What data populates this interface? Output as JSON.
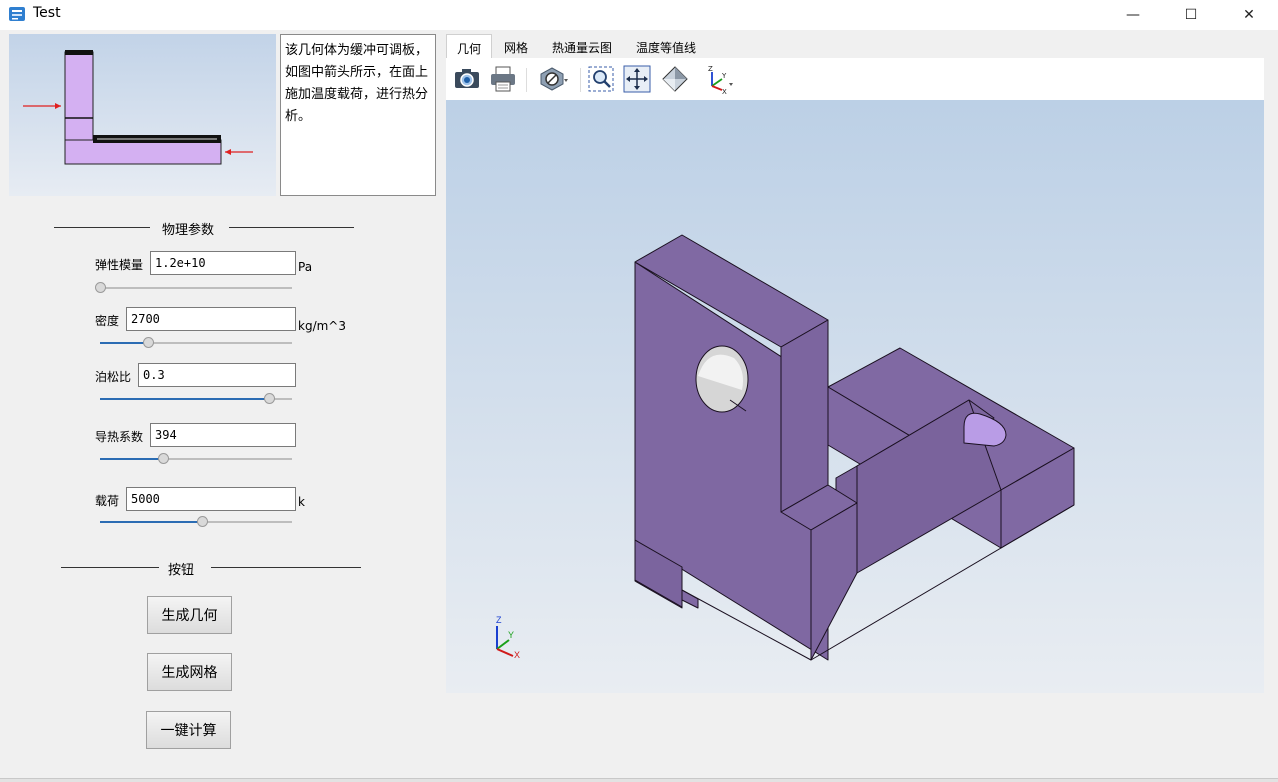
{
  "window": {
    "title": "Test",
    "minimize": "—",
    "maximize": "☐",
    "close": "✕"
  },
  "description": "该几何体为缓冲可调板，如图中箭头所示，在面上施加温度载荷，进行热分析。",
  "physics_group": {
    "title": "物理参数"
  },
  "params": [
    {
      "label": "弹性模量",
      "value": "1.2e+10",
      "unit": "Pa",
      "slider": 0.0
    },
    {
      "label": "密度",
      "value": "2700",
      "unit": "kg/m^3",
      "slider": 0.25
    },
    {
      "label": "泊松比",
      "value": "0.3",
      "unit": "",
      "slider": 0.88
    },
    {
      "label": "导热系数",
      "value": "394",
      "unit": "",
      "slider": 0.33
    },
    {
      "label": "载荷",
      "value": "5000",
      "unit": "k",
      "slider": 0.53
    }
  ],
  "buttons_group": {
    "title": "按钮"
  },
  "buttons": {
    "generate_geometry": "生成几何",
    "generate_mesh": "生成网格",
    "one_click_compute": "一键计算"
  },
  "tabs": [
    {
      "label": "几何",
      "active": true
    },
    {
      "label": "网格",
      "active": false
    },
    {
      "label": "热通量云图",
      "active": false
    },
    {
      "label": "温度等值线",
      "active": false
    }
  ],
  "toolbar_icons": [
    "camera-icon",
    "printer-icon",
    "clip-plane-icon",
    "zoom-window-icon",
    "fit-all-icon",
    "iso-view-icon",
    "axis-view-icon"
  ],
  "axis_labels": {
    "x": "X",
    "y": "Y",
    "z": "Z"
  },
  "colors": {
    "part_face": "#8069a3",
    "part_edge": "#1a1020",
    "preview_part": "#d4b0f2",
    "arrow": "#e02020",
    "accent": "#2b6cb3"
  }
}
